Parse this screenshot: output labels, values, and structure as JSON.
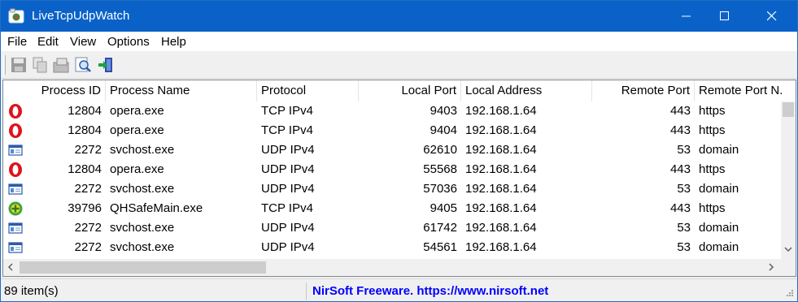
{
  "window": {
    "title": "LiveTcpUdpWatch",
    "minimize_label": "Minimize",
    "maximize_label": "Maximize",
    "close_label": "Close"
  },
  "menu": {
    "items": [
      {
        "label": "File"
      },
      {
        "label": "Edit"
      },
      {
        "label": "View"
      },
      {
        "label": "Options"
      },
      {
        "label": "Help"
      }
    ]
  },
  "toolbar": {
    "buttons": [
      {
        "icon": "save-icon"
      },
      {
        "icon": "copy-icon"
      },
      {
        "icon": "properties-icon"
      },
      {
        "icon": "find-icon"
      },
      {
        "icon": "exit-icon"
      }
    ]
  },
  "table": {
    "columns": [
      {
        "label": "Process ID"
      },
      {
        "label": "Process Name"
      },
      {
        "label": "Protocol"
      },
      {
        "label": "Local Port"
      },
      {
        "label": "Local Address"
      },
      {
        "label": "Remote Port"
      },
      {
        "label": "Remote Port N..."
      }
    ],
    "rows": [
      {
        "icon": "opera-icon",
        "pid": "12804",
        "name": "opera.exe",
        "protocol": "TCP IPv4",
        "local_port": "9403",
        "local_address": "192.168.1.64",
        "remote_port": "443",
        "remote_port_name": "https"
      },
      {
        "icon": "opera-icon",
        "pid": "12804",
        "name": "opera.exe",
        "protocol": "TCP IPv4",
        "local_port": "9404",
        "local_address": "192.168.1.64",
        "remote_port": "443",
        "remote_port_name": "https"
      },
      {
        "icon": "service-icon",
        "pid": "2272",
        "name": "svchost.exe",
        "protocol": "UDP IPv4",
        "local_port": "62610",
        "local_address": "192.168.1.64",
        "remote_port": "53",
        "remote_port_name": "domain"
      },
      {
        "icon": "opera-icon",
        "pid": "12804",
        "name": "opera.exe",
        "protocol": "UDP IPv4",
        "local_port": "55568",
        "local_address": "192.168.1.64",
        "remote_port": "443",
        "remote_port_name": "https"
      },
      {
        "icon": "service-icon",
        "pid": "2272",
        "name": "svchost.exe",
        "protocol": "UDP IPv4",
        "local_port": "57036",
        "local_address": "192.168.1.64",
        "remote_port": "53",
        "remote_port_name": "domain"
      },
      {
        "icon": "qhsafe-icon",
        "pid": "39796",
        "name": "QHSafeMain.exe",
        "protocol": "TCP IPv4",
        "local_port": "9405",
        "local_address": "192.168.1.64",
        "remote_port": "443",
        "remote_port_name": "https"
      },
      {
        "icon": "service-icon",
        "pid": "2272",
        "name": "svchost.exe",
        "protocol": "UDP IPv4",
        "local_port": "61742",
        "local_address": "192.168.1.64",
        "remote_port": "53",
        "remote_port_name": "domain"
      },
      {
        "icon": "service-icon",
        "pid": "2272",
        "name": "svchost.exe",
        "protocol": "UDP IPv4",
        "local_port": "54561",
        "local_address": "192.168.1.64",
        "remote_port": "53",
        "remote_port_name": "domain"
      }
    ]
  },
  "status": {
    "count": "89 item(s)",
    "link": "NirSoft Freeware. https://www.nirsoft.net"
  },
  "colors": {
    "titlebar": "#0a62c9",
    "link": "#0000ff",
    "opera_red": "#e0121c",
    "qhsafe_green": "#3aa83a"
  }
}
